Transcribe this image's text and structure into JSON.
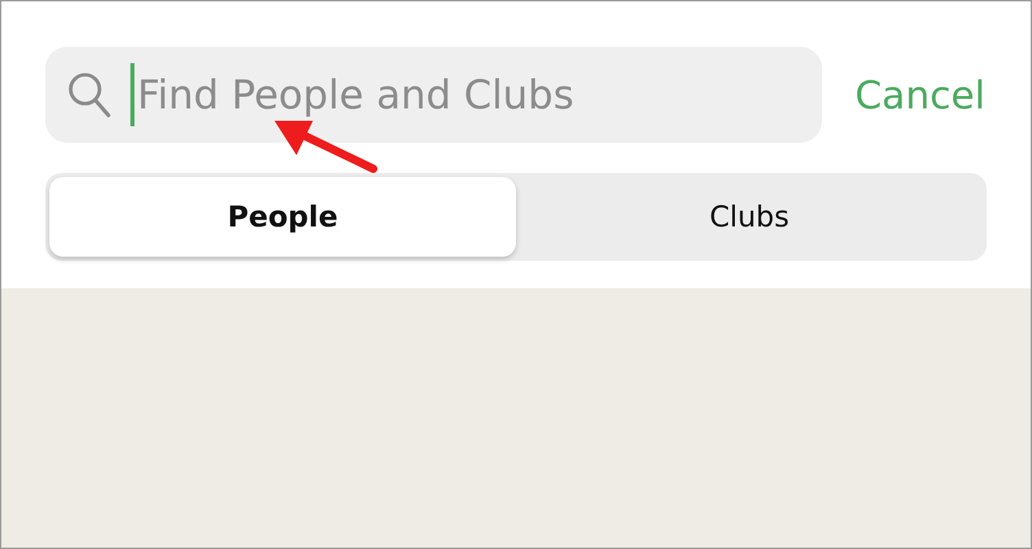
{
  "search": {
    "placeholder": "Find People and Clubs",
    "focused": true
  },
  "cancel_button": "Cancel",
  "segments": [
    {
      "label": "People",
      "selected": true
    },
    {
      "label": "Clubs",
      "selected": false
    }
  ]
}
